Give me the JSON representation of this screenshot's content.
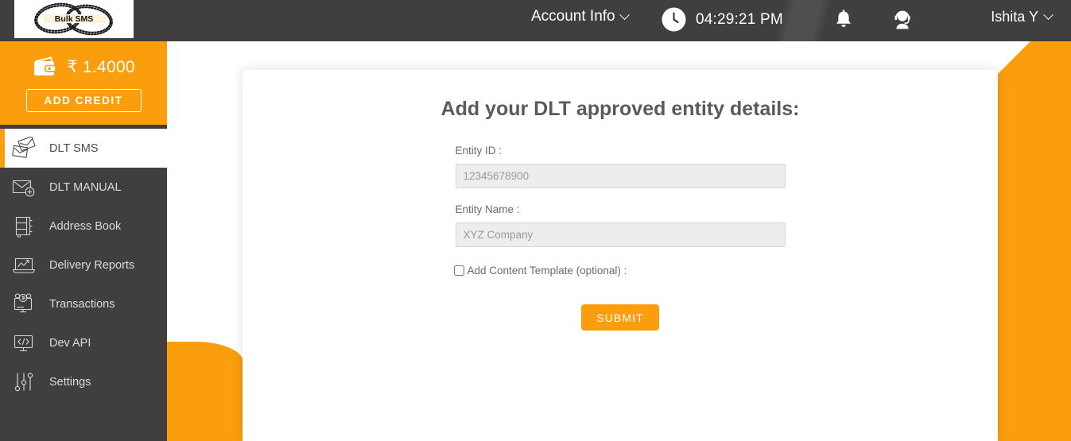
{
  "header": {
    "logo_text": "Bulk SMS",
    "account_info_label": "Account Info",
    "time": "04:29:21 PM",
    "user_name": "Ishita Y",
    "icons": {
      "clock": "clock-icon",
      "bell": "bell-icon",
      "support": "support-agent-icon",
      "chevron": "chevron-down-icon"
    }
  },
  "sidebar": {
    "wallet": {
      "balance": "₹ 1.4000",
      "add_credit_label": "ADD CREDIT",
      "icon": "wallet-icon"
    },
    "items": [
      {
        "label": "DLT SMS",
        "icon": "envelopes-icon",
        "active": true
      },
      {
        "label": "DLT MANUAL",
        "icon": "envelope-plus-icon",
        "active": false
      },
      {
        "label": "Address Book",
        "icon": "address-book-icon",
        "active": false
      },
      {
        "label": "Delivery Reports",
        "icon": "chart-laptop-icon",
        "active": false
      },
      {
        "label": "Transactions",
        "icon": "monitor-currency-icon",
        "active": false
      },
      {
        "label": "Dev API",
        "icon": "code-monitor-icon",
        "active": false
      },
      {
        "label": "Settings",
        "icon": "sliders-icon",
        "active": false
      }
    ]
  },
  "main": {
    "title": "Add your DLT approved entity details:",
    "fields": [
      {
        "label": "Entity ID :",
        "placeholder": "12345678900",
        "value": ""
      },
      {
        "label": "Entity Name :",
        "placeholder": "XYZ Company",
        "value": ""
      }
    ],
    "checkbox": {
      "label": "Add Content Template (optional) :",
      "checked": false
    },
    "submit_label": "SUBMIT"
  },
  "colors": {
    "accent_orange": "#FA9E0D",
    "dark_gray": "#403E3E",
    "input_bg": "#EDEDED"
  }
}
